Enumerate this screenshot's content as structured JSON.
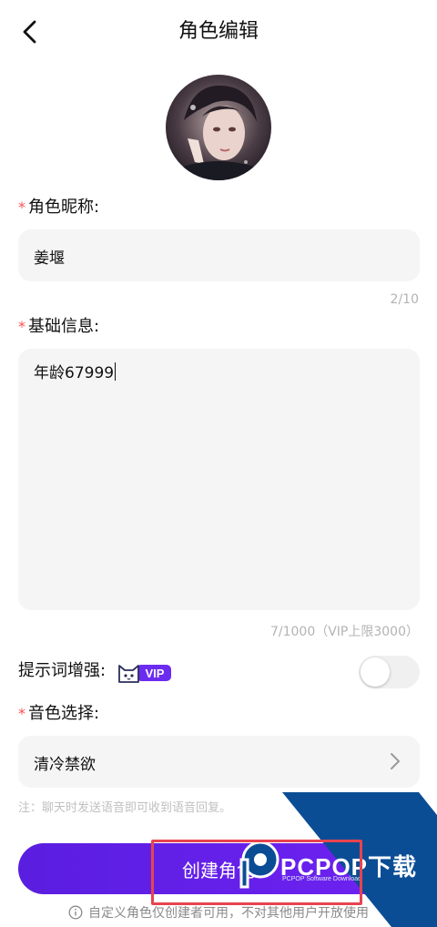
{
  "header": {
    "title": "角色编辑"
  },
  "icons": {
    "back": "chevron-left-icon",
    "arrow": "chevron-right-icon",
    "info": "info-icon",
    "vip": "cat-vip-icon"
  },
  "nickname": {
    "label": "角色昵称:",
    "value": "姜堰",
    "counter": "2/10"
  },
  "basic_info": {
    "label": "基础信息:",
    "value": "年龄67999",
    "counter": "7/1000（VIP上限3000）"
  },
  "prompt_enhance": {
    "label": "提示词增强:",
    "vip_text": "VIP",
    "enabled": false
  },
  "voice": {
    "label": "音色选择:",
    "value": "清冷禁欲",
    "note": "注：聊天时发送语音即可收到语音回复。"
  },
  "create_button": {
    "label": "创建角色"
  },
  "footer": {
    "text": "自定义角色仅创建者可用，不对其他用户开放使用"
  },
  "watermark": {
    "text": "PCPOP下载",
    "sub": "PCPOP Software Download"
  },
  "colors": {
    "primary": "#6b21ee",
    "required": "#ff4d4f",
    "field_bg": "#f5f5f5",
    "watermark": "#0b4d95"
  }
}
